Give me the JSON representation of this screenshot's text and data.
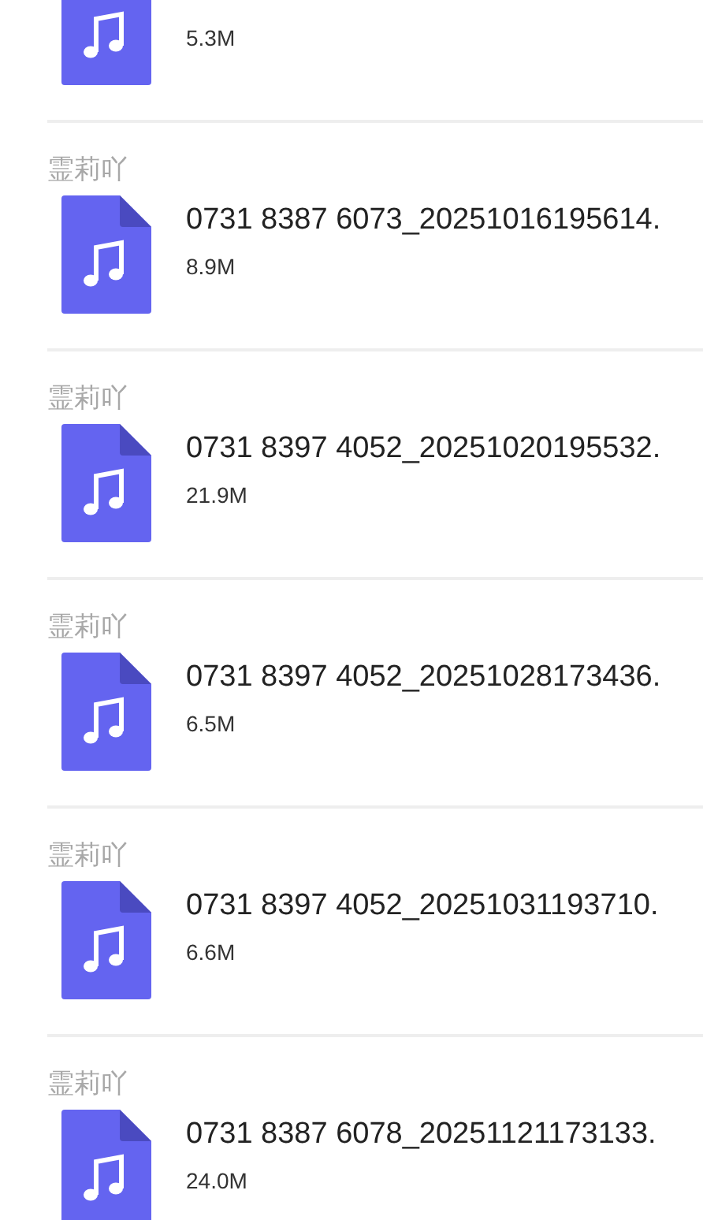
{
  "files": [
    {
      "size": "5.3M"
    },
    {
      "sender": "霊莉吖",
      "name": "0731 8387 6073_20251016195614.",
      "size": "8.9M"
    },
    {
      "sender": "霊莉吖",
      "name": "0731 8397 4052_20251020195532.",
      "size": "21.9M"
    },
    {
      "sender": "霊莉吖",
      "name": "0731 8397 4052_20251028173436.",
      "size": "6.5M"
    },
    {
      "sender": "霊莉吖",
      "name": "0731 8397 4052_20251031193710.",
      "size": "6.6M"
    },
    {
      "sender": "霊莉吖",
      "name": "0731 8387 6078_20251121173133.",
      "size": "24.0M"
    }
  ]
}
